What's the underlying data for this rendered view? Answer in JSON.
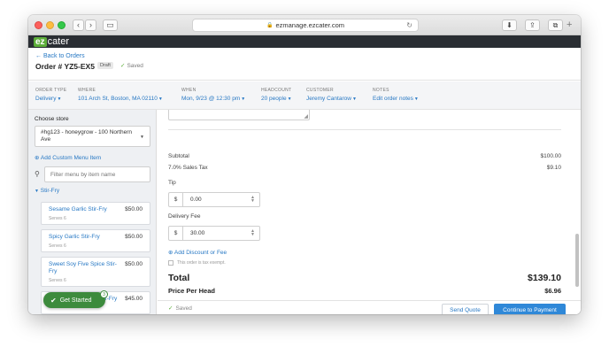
{
  "browser": {
    "url": "ezmanage.ezcater.com",
    "back_glyph": "‹",
    "forward_glyph": "›",
    "sidebar_glyph": "▭",
    "download_glyph": "⬇",
    "share_glyph": "⇪",
    "tabs_glyph": "⧉",
    "reload_glyph": "↻",
    "lock_glyph": "🔒",
    "plus_glyph": "+"
  },
  "app": {
    "logo_ez": "ez",
    "logo_cater": "cater"
  },
  "order": {
    "back_label": "← Back to Orders",
    "title": "Order # YZ5-EX5",
    "draft_badge": "Draft",
    "saved_label": "Saved"
  },
  "info": [
    {
      "label": "ORDER TYPE",
      "value": "Delivery"
    },
    {
      "label": "WHERE",
      "value": "101 Arch St, Boston, MA 02110"
    },
    {
      "label": "WHEN",
      "value": "Mon, 9/23 @ 12:30 pm"
    },
    {
      "label": "HEADCOUNT",
      "value": "20 people"
    },
    {
      "label": "CUSTOMER",
      "value": "Jeremy Cantarow"
    },
    {
      "label": "NOTES",
      "value": "Edit order notes"
    }
  ],
  "sidebar": {
    "title": "Choose store",
    "store_value": "#hg123 - honeygrow - 100 Northern Ave",
    "add_custom": "Add Custom Menu Item",
    "filter_placeholder": "Filter menu by item name",
    "section": "Stir-Fry",
    "items": [
      {
        "name": "Sesame Garlic Stir-Fry",
        "serves": "Serves 6",
        "price": "$50.00"
      },
      {
        "name": "Spicy Garlic Stir-Fry",
        "serves": "Serves 6",
        "price": "$50.00"
      },
      {
        "name": "Sweet Soy Five Spice Stir-Fry",
        "serves": "Serves 6",
        "price": "$50.00"
      },
      {
        "name": "Stir-Fry",
        "serves": "",
        "price": "$45.00"
      }
    ]
  },
  "get_started": {
    "label": "Get Started",
    "badge": "3"
  },
  "summary": {
    "subtotal_label": "Subtotal",
    "subtotal_value": "$100.00",
    "tax_label": "7.0% Sales Tax",
    "tax_value": "$9.10",
    "tip_label": "Tip",
    "currency_symbol": "$",
    "tip_value": "0.00",
    "delivery_label": "Delivery Fee",
    "delivery_value": "30.00",
    "add_discount": "Add Discount or Fee",
    "tax_exempt": "This order is tax exempt.",
    "total_label": "Total",
    "total_value": "$139.10",
    "pph_label": "Price Per Head",
    "pph_value": "$6.96"
  },
  "footer": {
    "saved_label": "Saved",
    "send_quote": "Send Quote",
    "continue": "Continue to Payment"
  },
  "colors": {
    "accent": "#2778c4",
    "brand_green": "#5dae3a",
    "primary_button": "#2f88d8",
    "header_dark": "#2a2e33"
  }
}
